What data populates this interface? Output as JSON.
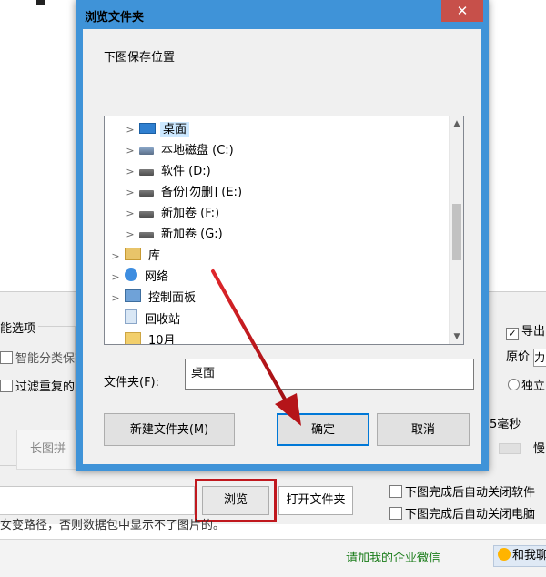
{
  "background_app": {
    "group_title": "能选项",
    "option_smart_category": "智能分类保存",
    "option_filter_duplicate": "过滤重复的图",
    "ghost_button": "长图拼接",
    "browse_button": "浏览",
    "open_folder_button": "打开文件夹",
    "hint_text": "女变路径，否则数据包中显示不了图片的。",
    "right_export": "导出",
    "right_price": "原价",
    "right_price_value": "力",
    "right_standalone": "独立",
    "right_ms": "5毫秒",
    "right_slider_label": "慢",
    "close_software": "下图完成后自动关闭软件",
    "shutdown_computer": "下图完成后自动关闭电脑",
    "status_wechat": "请加我的企业微信",
    "status_qq": "和我聊"
  },
  "dialog": {
    "title": "浏览文件夹",
    "close_glyph": "✕",
    "prompt": "下图保存位置",
    "tree": [
      {
        "label": "桌面",
        "icon": "desktop-icon",
        "selected": true
      },
      {
        "label": "本地磁盘 (C:)",
        "icon": "system-drive-icon"
      },
      {
        "label": "软件 (D:)",
        "icon": "drive-icon"
      },
      {
        "label": "备份[勿删] (E:)",
        "icon": "drive-icon"
      },
      {
        "label": "新加卷 (F:)",
        "icon": "drive-icon"
      },
      {
        "label": "新加卷 (G:)",
        "icon": "drive-icon"
      },
      {
        "label": "库",
        "icon": "library-icon"
      },
      {
        "label": "网络",
        "icon": "network-icon"
      },
      {
        "label": "控制面板",
        "icon": "control-panel-icon"
      },
      {
        "label": "回收站",
        "icon": "recycle-bin-icon"
      },
      {
        "label": "10月",
        "icon": "folder-icon"
      }
    ],
    "folder_label": "文件夹(F):",
    "folder_value": "桌面",
    "new_folder_button": "新建文件夹(M)",
    "ok_button": "确定",
    "cancel_button": "取消"
  },
  "colors": {
    "title_bar": "#3f93d8",
    "close_button": "#c7504a",
    "highlight_box": "#c0181e",
    "selected_item": "#cce8ff",
    "status_link": "#1b7d1b"
  }
}
